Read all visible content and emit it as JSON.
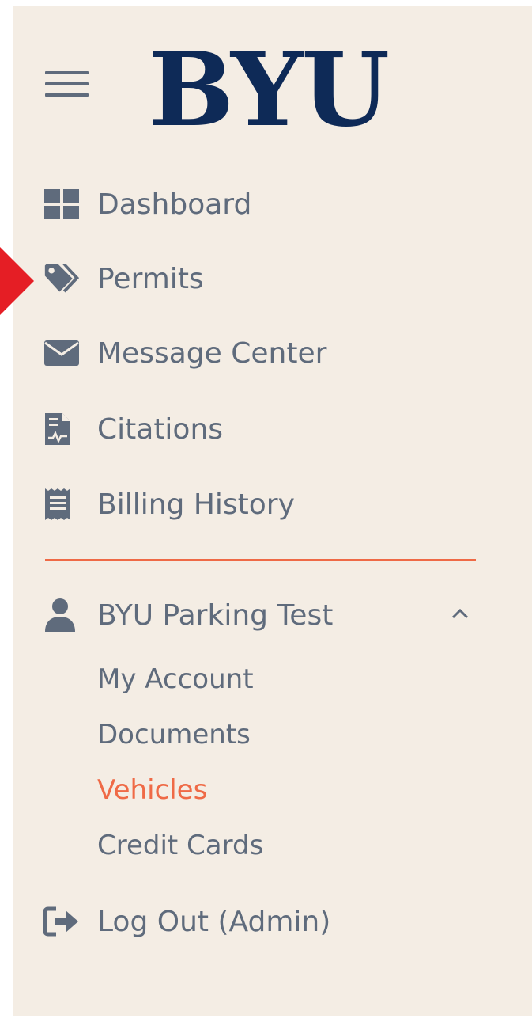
{
  "logo": {
    "text": "BYU",
    "color": "#0e2a57"
  },
  "menu_toggle": {
    "icon": "hamburger-menu-icon"
  },
  "nav": {
    "items": [
      {
        "label": "Dashboard",
        "icon": "dashboard-grid-icon"
      },
      {
        "label": "Permits",
        "icon": "tags-icon"
      },
      {
        "label": "Message Center",
        "icon": "envelope-icon"
      },
      {
        "label": "Citations",
        "icon": "citation-document-icon"
      },
      {
        "label": "Billing History",
        "icon": "receipt-icon"
      }
    ]
  },
  "account": {
    "name": "BYU Parking Test",
    "icon": "user-icon",
    "expanded": true,
    "sub_items": [
      {
        "label": "My Account",
        "active": false
      },
      {
        "label": "Documents",
        "active": false
      },
      {
        "label": "Vehicles",
        "active": true
      },
      {
        "label": "Credit Cards",
        "active": false
      }
    ]
  },
  "logout": {
    "label": "Log Out (Admin)",
    "icon": "sign-out-icon"
  },
  "colors": {
    "panel_bg": "#f4ede4",
    "text": "#5f6b7c",
    "accent": "#ef6a46",
    "pointer_arrow": "#e51e25"
  }
}
